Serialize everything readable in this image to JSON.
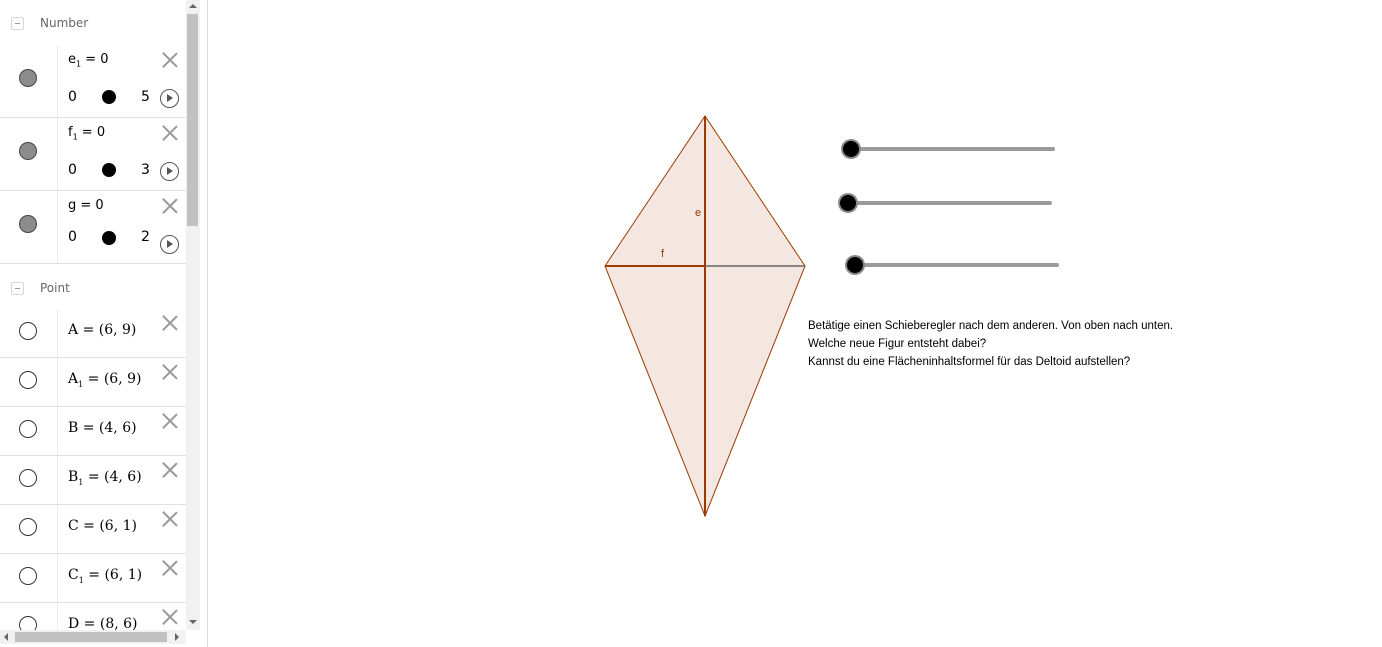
{
  "algebra": {
    "groups": [
      {
        "label": "Number"
      },
      {
        "label": "Point"
      }
    ],
    "numbers": [
      {
        "name": "e",
        "sub": "1",
        "eq": " = 0",
        "min": "0",
        "max": "5"
      },
      {
        "name": "f",
        "sub": "1",
        "eq": " = 0",
        "min": "0",
        "max": "3"
      },
      {
        "name": "g",
        "sub": "",
        "eq": " = 0",
        "min": "0",
        "max": "2"
      }
    ],
    "points": [
      {
        "name": "A",
        "sub": "",
        "value": " = (6, 9)"
      },
      {
        "name": "A",
        "sub": "1",
        "value": " = (6, 9)"
      },
      {
        "name": "B",
        "sub": "",
        "value": " = (4, 6)"
      },
      {
        "name": "B",
        "sub": "1",
        "value": " = (4, 6)"
      },
      {
        "name": "C",
        "sub": "",
        "value": " = (6, 1)"
      },
      {
        "name": "C",
        "sub": "1",
        "value": " = (6, 1)"
      },
      {
        "name": "D",
        "sub": "",
        "value": " = (8, 6)"
      }
    ]
  },
  "graphics": {
    "labels": {
      "e": "e",
      "f": "f"
    },
    "colors": {
      "stroke": "#9a3a00",
      "fill": "#f4e7e2",
      "gray_line": "#666666"
    },
    "sliders": [
      {
        "name": "e1-slider",
        "value": 0,
        "min": 0,
        "max": 5
      },
      {
        "name": "f1-slider",
        "value": 0,
        "min": 0,
        "max": 3
      },
      {
        "name": "g-slider",
        "value": 0,
        "min": 0,
        "max": 2
      }
    ],
    "task_lines": [
      "Betätige einen Schieberegler nach dem anderen. Von oben nach unten.",
      "Welche neue Figur entsteht dabei?",
      "Kannst du eine Flächeninhaltsformel für das Deltoid aufstellen?"
    ]
  }
}
